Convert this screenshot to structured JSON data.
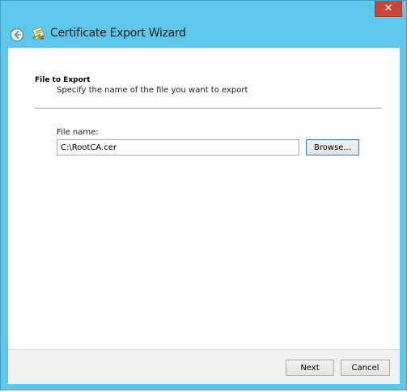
{
  "window": {
    "title": "Certificate Export Wizard",
    "close_glyph": "✕",
    "icons": {
      "close": "close-icon",
      "back": "back-arrow-icon",
      "wizard": "certificate-wizard-icon"
    }
  },
  "page": {
    "heading": "File to Export",
    "description": "Specify the name of the file you want to export"
  },
  "form": {
    "file_name_label": "File name:",
    "file_name_value": "C:\\RootCA.cer",
    "browse_label": "Browse..."
  },
  "footer": {
    "next_label": "Next",
    "cancel_label": "Cancel"
  },
  "colors": {
    "frame": "#5ec7ec",
    "close_button": "#c9463d",
    "content_bg": "#ffffff",
    "footer_bg": "#f0f0f0",
    "focus_border": "#3c7fb1"
  }
}
